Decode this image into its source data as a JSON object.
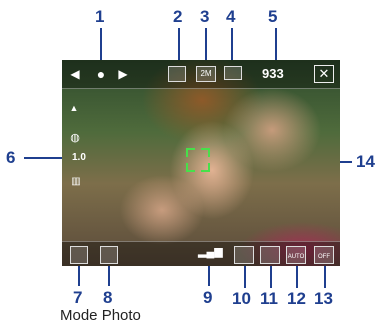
{
  "callouts": [
    "1",
    "2",
    "3",
    "4",
    "5",
    "6",
    "7",
    "8",
    "9",
    "10",
    "11",
    "12",
    "13",
    "14"
  ],
  "screen": {
    "shots_remaining": "933",
    "close_glyph": "✕",
    "zoom_text": "1.0",
    "wb_text": "AUTO",
    "flash_text": "OFF",
    "resolution_text": "2M"
  },
  "caption": "Mode Photo",
  "colors": {
    "callout": "#1f3f8f",
    "focus_bracket": "#47e04a"
  }
}
